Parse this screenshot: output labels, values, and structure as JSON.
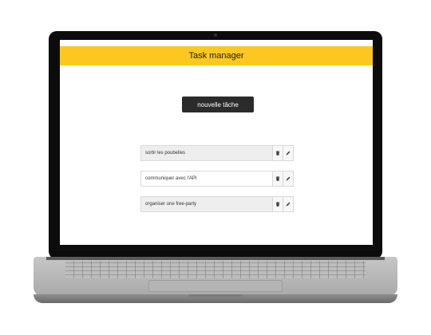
{
  "app": {
    "title": "Task manager",
    "new_task_label": "nouvelle tâche"
  },
  "tasks": [
    {
      "text": "sortir les poubelles",
      "highlighted": true
    },
    {
      "text": "communiquer avec l'API",
      "highlighted": false
    },
    {
      "text": "organiser une free-party",
      "highlighted": true
    }
  ],
  "task_actions": {
    "delete_icon": "trash-icon",
    "edit_icon": "pencil-icon"
  },
  "colors": {
    "header": "#fcc81f",
    "button": "#2b2b2b",
    "button_text": "#ffffff",
    "row_highlight": "#eeeeee",
    "laptop_bezel": "#0c0c0c",
    "laptop_body": "#b8b8b8"
  }
}
